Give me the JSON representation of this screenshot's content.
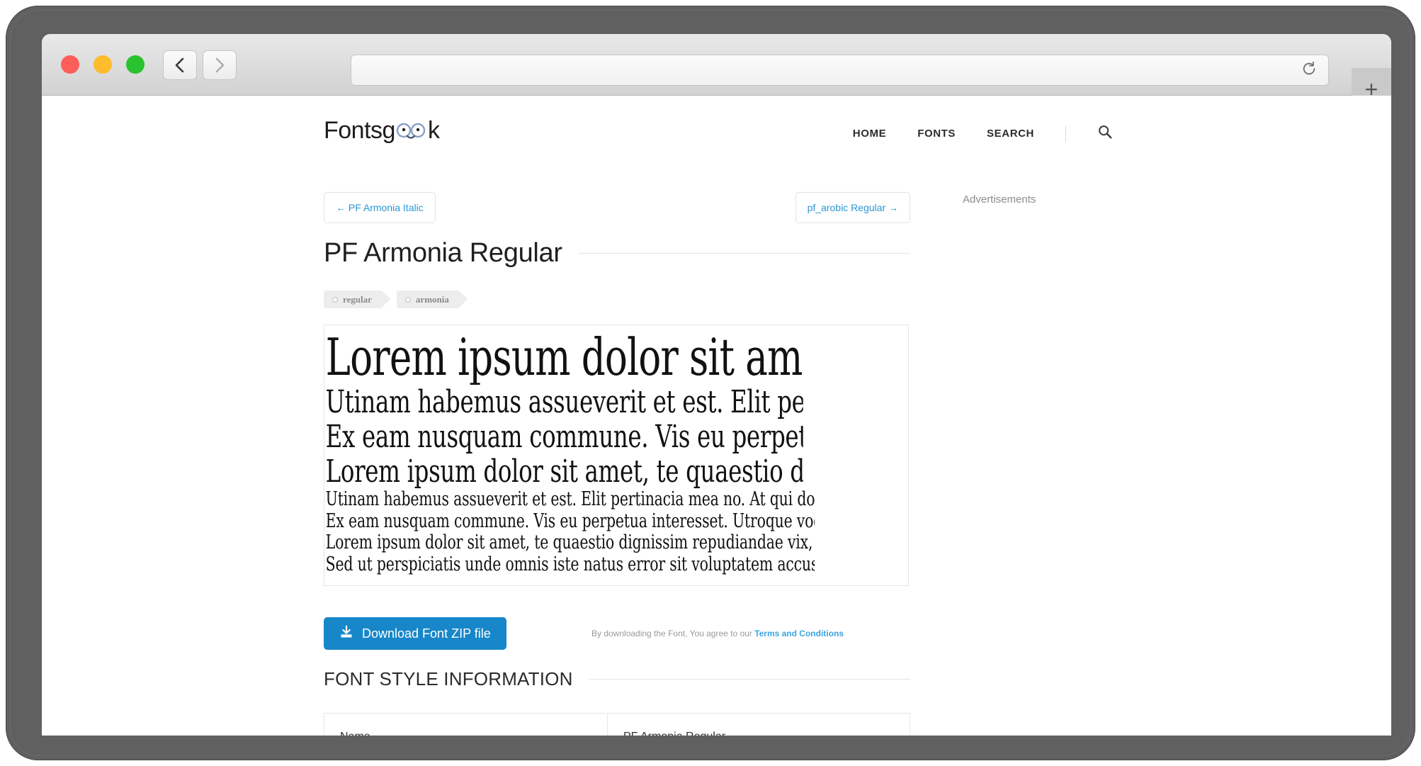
{
  "browser": {
    "traffic_lights": [
      "close",
      "minimize",
      "maximize"
    ],
    "back_label": "Back",
    "forward_label": "Forward",
    "url_value": "",
    "url_placeholder": "",
    "reload_label": "Reload",
    "new_tab_label": "+"
  },
  "site": {
    "logo_part1": "Fonts",
    "logo_part2": "g",
    "logo_part3": "k",
    "nav": [
      {
        "label": "HOME"
      },
      {
        "label": "FONTS"
      },
      {
        "label": "SEARCH"
      }
    ],
    "search_icon_label": "Search"
  },
  "pager": {
    "prev_label": "← PF Armonia Italic",
    "next_label": "pf_arobic Regular →"
  },
  "page": {
    "title": "PF Armonia Regular",
    "tags": [
      {
        "label": "regular"
      },
      {
        "label": "armonia"
      }
    ]
  },
  "preview": {
    "lines": [
      "Lorem ipsum dolor sit amet, te quaestio dignissim",
      "Utinam habemus assueverit et est. Elit pertinacia mea no. At",
      "Ex eam nusquam commune. Vis eu perpetua interesset. Utro",
      "Lorem ipsum dolor sit amet, te quaestio dignissim repudiand",
      "Utinam habemus assueverit et est. Elit pertinacia mea no. At qui dolor",
      "Ex eam nusquam commune. Vis eu perpetua interesset. Utroque vocibus",
      "Lorem ipsum dolor sit amet, te quaestio dignissim repudiandae vix, eum",
      "Sed ut perspiciatis unde omnis iste natus error sit voluptatem accusantium"
    ]
  },
  "download": {
    "button_label": "Download Font ZIP file",
    "icon": "download-icon",
    "terms_prefix": "By downloading the Font, You agree to our ",
    "terms_link": "Terms and Conditions"
  },
  "font_style_information": {
    "title": "FONT STYLE INFORMATION",
    "rows": [
      {
        "key": "Name",
        "value": "PF Armonia Regular"
      }
    ]
  },
  "ads": {
    "label": "Advertisements"
  },
  "colors": {
    "accent_blue": "#1787c9",
    "link_blue": "#2a97d4",
    "tag_gray": "#ededed",
    "bezel_gray": "#606060"
  }
}
